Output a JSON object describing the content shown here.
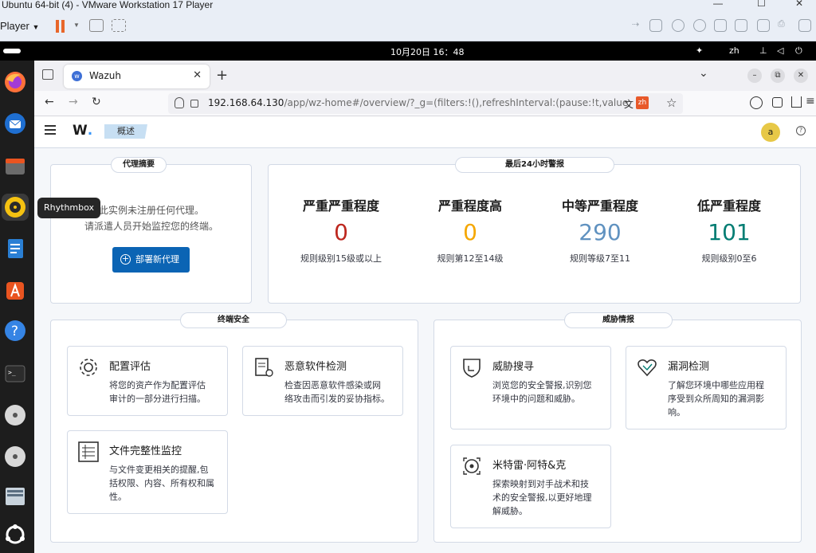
{
  "vm": {
    "title": "Ubuntu 64-bit (4) - VMware Workstation 17 Player",
    "player_label": "Player",
    "player_arrow": "▼",
    "min": "—",
    "max": "☐",
    "close": "✕"
  },
  "ubuntu": {
    "clock": "10月20日 16：48",
    "lang": "zh",
    "tooltip": "Rhythmbox"
  },
  "browser": {
    "tab_title": "Wazuh",
    "tab_close": "✕",
    "new_tab": "+",
    "url_host": "192.168.64.130",
    "url_path": "/app/wz-home#/overview/?_g=(filters:!(),refreshInterval:(pause:!t,value:0),time:",
    "translate_label": "zh",
    "tab_list": "⌄",
    "win_min": "–",
    "win_restore": "⧉",
    "win_close": "✕",
    "back": "←",
    "forward": "→",
    "reload": "↻",
    "bookmark": "☆",
    "menu": "≡"
  },
  "wazuh": {
    "logo_letter": "W",
    "logo_dot": ".",
    "breadcrumb": "概述",
    "avatar": "a",
    "help": "?",
    "agents_summary": {
      "title": "代理摘要",
      "line1": "此实例未注册任何代理。",
      "line2": "请派遣人员开始监控您的终端。",
      "deploy_plus": "+",
      "deploy_button": "部署新代理"
    },
    "alerts": {
      "title": "最后24小时警报",
      "stats": [
        {
          "label": "严重严重程度",
          "value": "0",
          "sub": "规则级别15级或以上",
          "color": "#bd271e"
        },
        {
          "label": "严重程度高",
          "value": "0",
          "sub": "规则第12至14级",
          "color": "#f5a700"
        },
        {
          "label": "中等严重程度",
          "value": "290",
          "sub": "规则等级7至11",
          "color": "#6092c0"
        },
        {
          "label": "低严重程度",
          "value": "101",
          "sub": "规则级别0至6",
          "color": "#017d73"
        }
      ]
    },
    "endpoint": {
      "title": "终端安全",
      "cards": [
        {
          "title": "配置评估",
          "desc1": "将您的资产作为配置评估",
          "desc2": "审计的一部分进行扫描。",
          "icon": "gear-icon"
        },
        {
          "title": "恶意软件检测",
          "desc1": "检查因恶意软件感染或网",
          "desc2": "络攻击而引发的妥协指标。",
          "icon": "document-gear-icon"
        },
        {
          "title": "文件完整性监控",
          "desc1": "与文件变更相关的提醒,包",
          "desc2": "括权限、内容、所有权和属",
          "desc3": "性。",
          "icon": "list-icon"
        }
      ]
    },
    "threat": {
      "title": "威胁情报",
      "cards": [
        {
          "title": "威胁搜寻",
          "desc1": "浏览您的安全警报,识别您",
          "desc2": "环境中的问题和威胁。",
          "icon": "shield-icon"
        },
        {
          "title": "漏洞检测",
          "desc1": "了解您环境中哪些应用程",
          "desc2": "序受到众所周知的漏洞影",
          "desc3": "响。",
          "icon": "heart-icon"
        },
        {
          "title": "米特雷·阿特&克",
          "desc1": "探索映射到对手战术和技",
          "desc2": "术的安全警报,以更好地理",
          "desc3": "解威胁。",
          "icon": "target-icon"
        }
      ]
    }
  }
}
